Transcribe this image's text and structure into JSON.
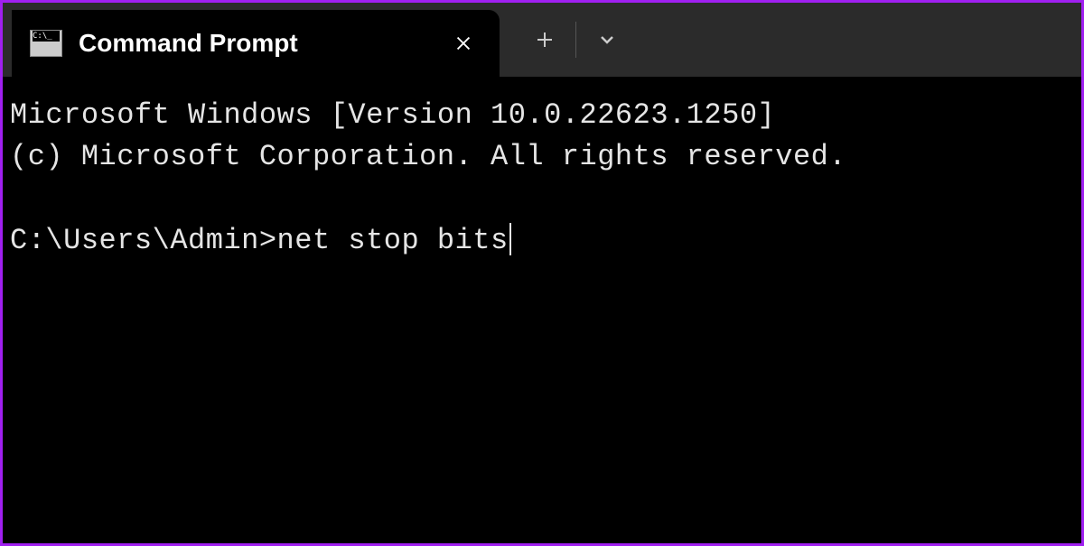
{
  "tab": {
    "title": "Command Prompt"
  },
  "terminal": {
    "line1": "Microsoft Windows [Version 10.0.22623.1250]",
    "line2": "(c) Microsoft Corporation. All rights reserved.",
    "prompt": "C:\\Users\\Admin>",
    "command": "net stop bits"
  }
}
